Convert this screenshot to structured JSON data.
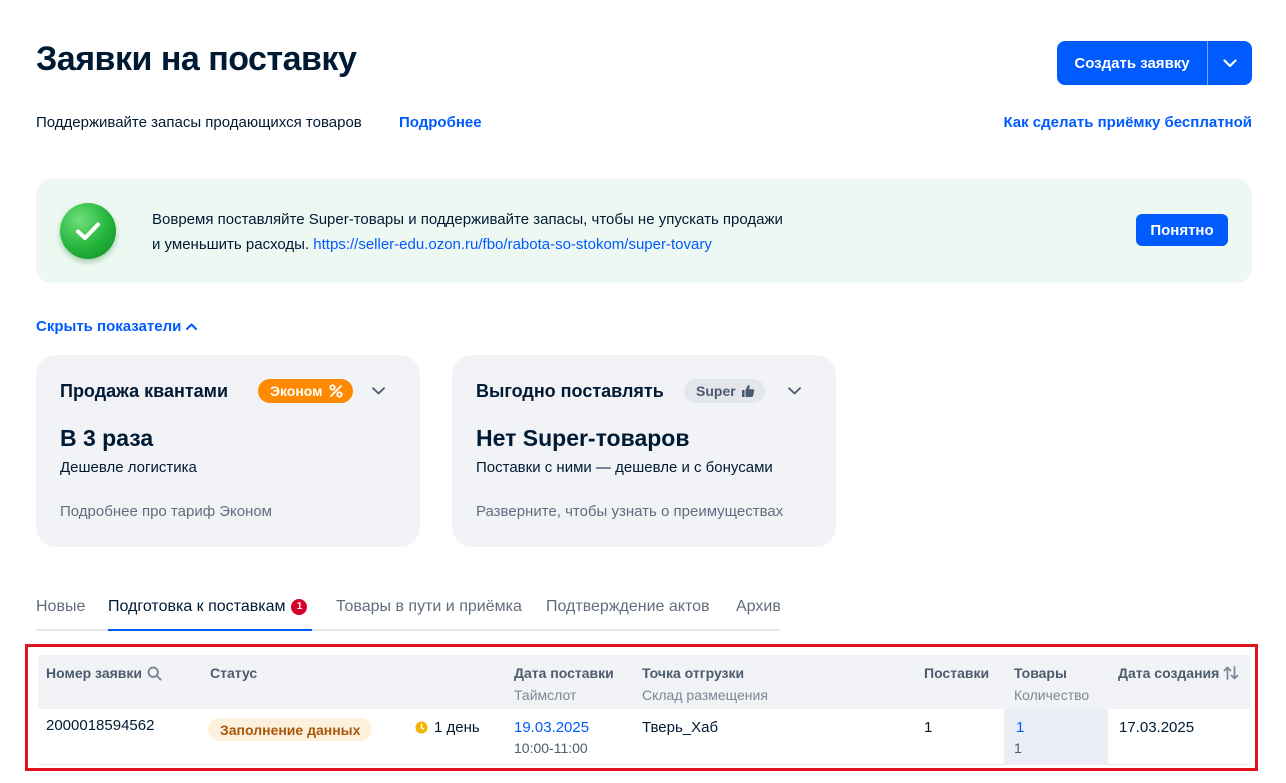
{
  "header": {
    "title": "Заявки на поставку",
    "create_button": "Создать заявку",
    "subtitle": "Поддерживайте запасы продающихся товаров",
    "more_link": "Подробнее",
    "free_link": "Как сделать приёмку бесплатной"
  },
  "banner": {
    "line1": "Вовремя поставляйте Super-товары и поддерживайте запасы, чтобы не упускать продажи",
    "line2_prefix": "и уменьшить расходы. ",
    "link": "https://seller-edu.ozon.ru/fbo/rabota-so-stokom/super-tovary",
    "button": "Понятно"
  },
  "toggle_metrics": "Скрыть показатели",
  "cards": [
    {
      "title": "Продажа квантами",
      "badge": "Эконом",
      "big": "В 3 раза",
      "desc": "Дешевле логистика",
      "foot": "Подробнее про тариф Эконом"
    },
    {
      "title": "Выгодно поставлять",
      "badge": "Super",
      "big": "Нет Super-товаров",
      "desc": "Поставки с ними — дешевле и с бонусами",
      "foot": "Разверните, чтобы узнать о преимуществах"
    }
  ],
  "tabs": [
    {
      "label": "Новые"
    },
    {
      "label": "Подготовка к поставкам",
      "count": "1"
    },
    {
      "label": "Товары в пути и приёмка"
    },
    {
      "label": "Подтверждение актов"
    },
    {
      "label": "Архив"
    }
  ],
  "table": {
    "columns": {
      "number": "Номер заявки",
      "status": "Статус",
      "delivery_date": "Дата поставки",
      "delivery_date_sub": "Таймслот",
      "shipment_point": "Точка отгрузки",
      "shipment_point_sub": "Склад размещения",
      "supplies": "Поставки",
      "goods": "Товары",
      "goods_sub": "Количество",
      "created": "Дата создания"
    },
    "rows": [
      {
        "number": "2000018594562",
        "status": "Заполнение данных",
        "timer": "1 день",
        "delivery_date": "19.03.2025",
        "timeslot": "10:00-11:00",
        "shipment_point": "Тверь_Хаб",
        "supplies": "1",
        "goods": "1",
        "quantity": "1",
        "created": "17.03.2025"
      }
    ]
  }
}
